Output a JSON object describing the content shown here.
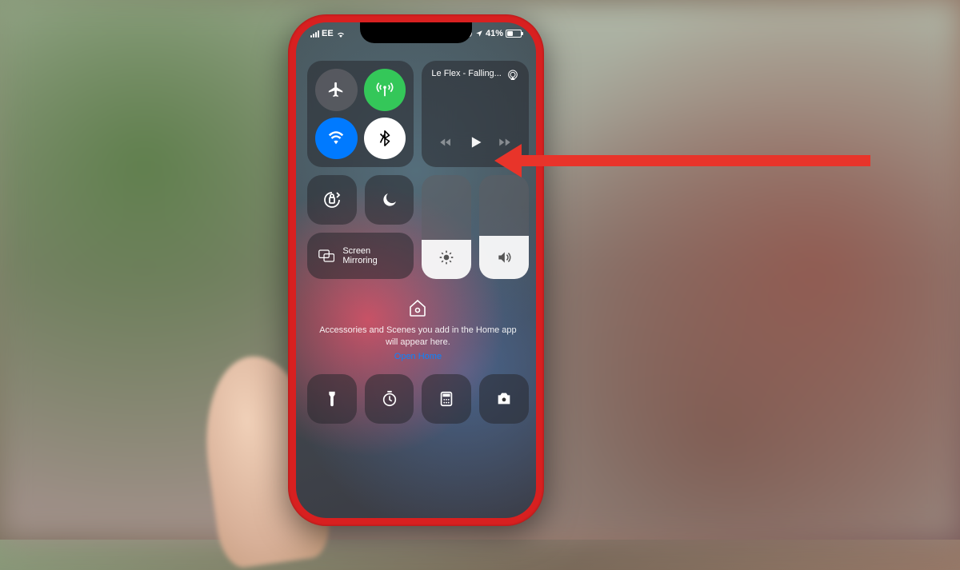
{
  "status": {
    "carrier": "EE",
    "battery_percent": "41%"
  },
  "connectivity": {
    "airplane": "airplane-mode",
    "cellular": "cellular-data",
    "wifi": "wifi",
    "bluetooth": "bluetooth"
  },
  "media": {
    "now_playing": "Le Flex - Falling...",
    "airplay": "airplay-audio"
  },
  "toggles": {
    "orientation_lock": "orientation-lock",
    "dnd": "do-not-disturb"
  },
  "mirror": {
    "label": "Screen Mirroring"
  },
  "sliders": {
    "brightness_level": 38,
    "volume_level": 42
  },
  "home": {
    "message": "Accessories and Scenes you add in the Home app will appear here.",
    "link": "Open Home"
  },
  "bottom": {
    "flashlight": "flashlight",
    "timer": "timer",
    "calculator": "calculator",
    "camera": "camera"
  },
  "annotation": {
    "arrow_target": "play-button"
  }
}
